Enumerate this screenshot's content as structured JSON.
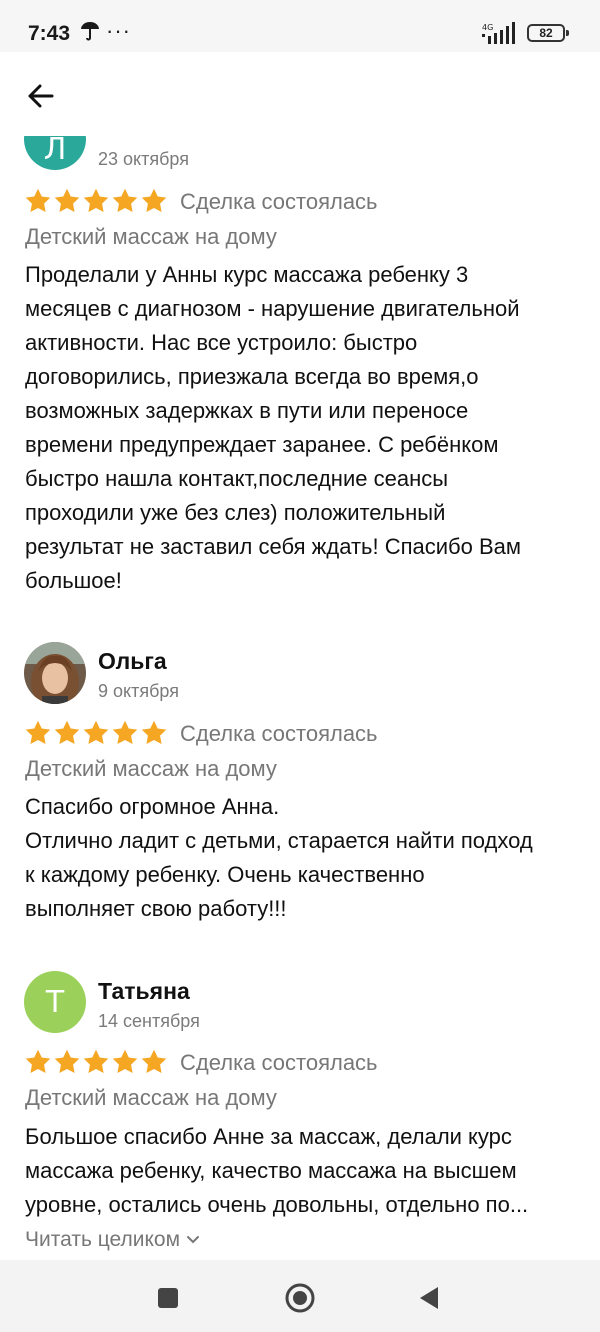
{
  "status_bar": {
    "time": "7:43",
    "extra": "···",
    "network": "4G",
    "battery": "82"
  },
  "header": {
    "back_icon": "arrow-left-icon"
  },
  "reviews": [
    {
      "author": "",
      "avatar_letter": "Л",
      "avatar_color": "#2aa89a",
      "date": "23 октября",
      "rating": 5,
      "deal_status": "Сделка состоялась",
      "service": "Детский массаж на дому",
      "text": "Проделали у Анны курс массажа ребенку 3\nмесяцев с диагнозом - нарушение двигательной\nактивности. Нас все устроило: быстро\nдоговорились, приезжала всегда во время,о\nвозможных задержках в пути или переносе\nвремени предупреждает заранее. С ребёнком\nбыстро нашла контакт,последние сеансы\nпроходили уже без слез) положительный\nрезультат не заставил себя ждать! Спасибо Вам\nбольшое!"
    },
    {
      "author": "Ольга",
      "avatar_letter": "",
      "avatar_color": "#8a6a4a",
      "date": "9 октября",
      "rating": 5,
      "deal_status": "Сделка состоялась",
      "service": "Детский массаж на дому",
      "text": "Спасибо огромное Анна.\nОтлично ладит с детьми, старается найти подход\nк каждому ребенку. Очень качественно\nвыполняет свою работу!!!"
    },
    {
      "author": "Татьяна",
      "avatar_letter": "Т",
      "avatar_color": "#9bd15a",
      "date": "14 сентября",
      "rating": 5,
      "deal_status": "Сделка состоялась",
      "service": "Детский массаж на дому",
      "text": "Большое спасибо Анне за массаж, делали курс\nмассажа ребенку, качество массажа на высшем\nуровне, остались очень довольны, отдельно по...",
      "read_more": "Читать целиком"
    }
  ],
  "colors": {
    "star": "#f5a623",
    "muted_text": "#777777"
  },
  "nav_bar": {
    "icons": [
      "square-recents-icon",
      "circle-home-icon",
      "triangle-back-icon"
    ]
  }
}
